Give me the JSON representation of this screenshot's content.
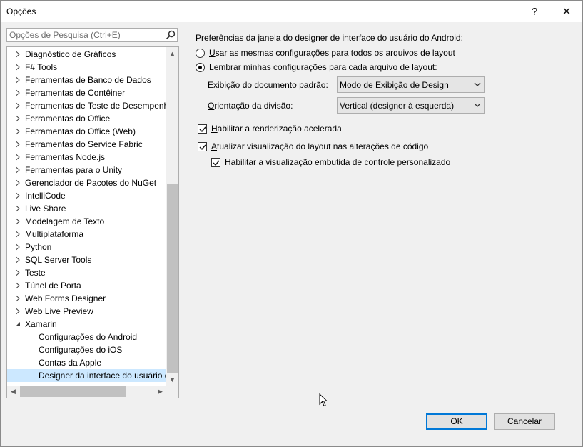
{
  "window": {
    "title": "Opções",
    "help_label": "?",
    "close_label": "✕"
  },
  "search": {
    "placeholder": "Opções de Pesquisa (Ctrl+E)",
    "value": ""
  },
  "tree": {
    "items": [
      {
        "label": "Diagnóstico de Gráficos",
        "state": "collapsed",
        "level": 0
      },
      {
        "label": "F# Tools",
        "state": "collapsed",
        "level": 0
      },
      {
        "label": "Ferramentas de Banco de Dados",
        "state": "collapsed",
        "level": 0
      },
      {
        "label": "Ferramentas de Contêiner",
        "state": "collapsed",
        "level": 0
      },
      {
        "label": "Ferramentas de Teste de Desempenho",
        "state": "collapsed",
        "level": 0
      },
      {
        "label": "Ferramentas do Office",
        "state": "collapsed",
        "level": 0
      },
      {
        "label": "Ferramentas do Office (Web)",
        "state": "collapsed",
        "level": 0
      },
      {
        "label": "Ferramentas do Service Fabric",
        "state": "collapsed",
        "level": 0
      },
      {
        "label": "Ferramentas Node.js",
        "state": "collapsed",
        "level": 0
      },
      {
        "label": "Ferramentas para o Unity",
        "state": "collapsed",
        "level": 0
      },
      {
        "label": "Gerenciador de Pacotes do NuGet",
        "state": "collapsed",
        "level": 0
      },
      {
        "label": "IntelliCode",
        "state": "collapsed",
        "level": 0
      },
      {
        "label": "Live Share",
        "state": "collapsed",
        "level": 0
      },
      {
        "label": "Modelagem de Texto",
        "state": "collapsed",
        "level": 0
      },
      {
        "label": "Multiplataforma",
        "state": "collapsed",
        "level": 0
      },
      {
        "label": "Python",
        "state": "collapsed",
        "level": 0
      },
      {
        "label": "SQL Server Tools",
        "state": "collapsed",
        "level": 0
      },
      {
        "label": "Teste",
        "state": "collapsed",
        "level": 0
      },
      {
        "label": "Túnel de Porta",
        "state": "collapsed",
        "level": 0
      },
      {
        "label": "Web Forms Designer",
        "state": "collapsed",
        "level": 0
      },
      {
        "label": "Web Live Preview",
        "state": "collapsed",
        "level": 0
      },
      {
        "label": "Xamarin",
        "state": "expanded",
        "level": 0
      },
      {
        "label": "Configurações do Android",
        "state": "leaf",
        "level": 1
      },
      {
        "label": "Configurações do iOS",
        "state": "leaf",
        "level": 1
      },
      {
        "label": "Contas da Apple",
        "state": "leaf",
        "level": 1
      },
      {
        "label": "Designer da interface do usuário do Android",
        "state": "leaf",
        "level": 1,
        "selected": true
      }
    ]
  },
  "panel": {
    "heading": "Preferências da janela do designer de interface do usuário do Android:",
    "radio_same": {
      "u": "U",
      "rest": "sar as mesmas configurações para todos os arquivos de layout",
      "checked": false
    },
    "radio_remember": {
      "u": "L",
      "rest": "embrar minhas configurações para cada arquivo de layout:",
      "checked": true
    },
    "default_view": {
      "pre": "Exibição do documento ",
      "u": "p",
      "post": "adrão:",
      "value": "Modo de Exibição de Design"
    },
    "split_orient": {
      "u": "O",
      "post": "rientação da divisão:",
      "value": "Vertical (designer à esquerda)"
    },
    "accel": {
      "u": "H",
      "rest": "abilitar a renderização acelerada",
      "checked": true
    },
    "auto_update": {
      "u": "A",
      "rest": "tualizar visualização do layout nas alterações de código",
      "checked": true
    },
    "custom_ctrl": {
      "pre": "Habilitar a ",
      "u": "v",
      "post": "isualização embutida de controle personalizado",
      "checked": true
    }
  },
  "buttons": {
    "ok": "OK",
    "cancel": "Cancelar"
  }
}
